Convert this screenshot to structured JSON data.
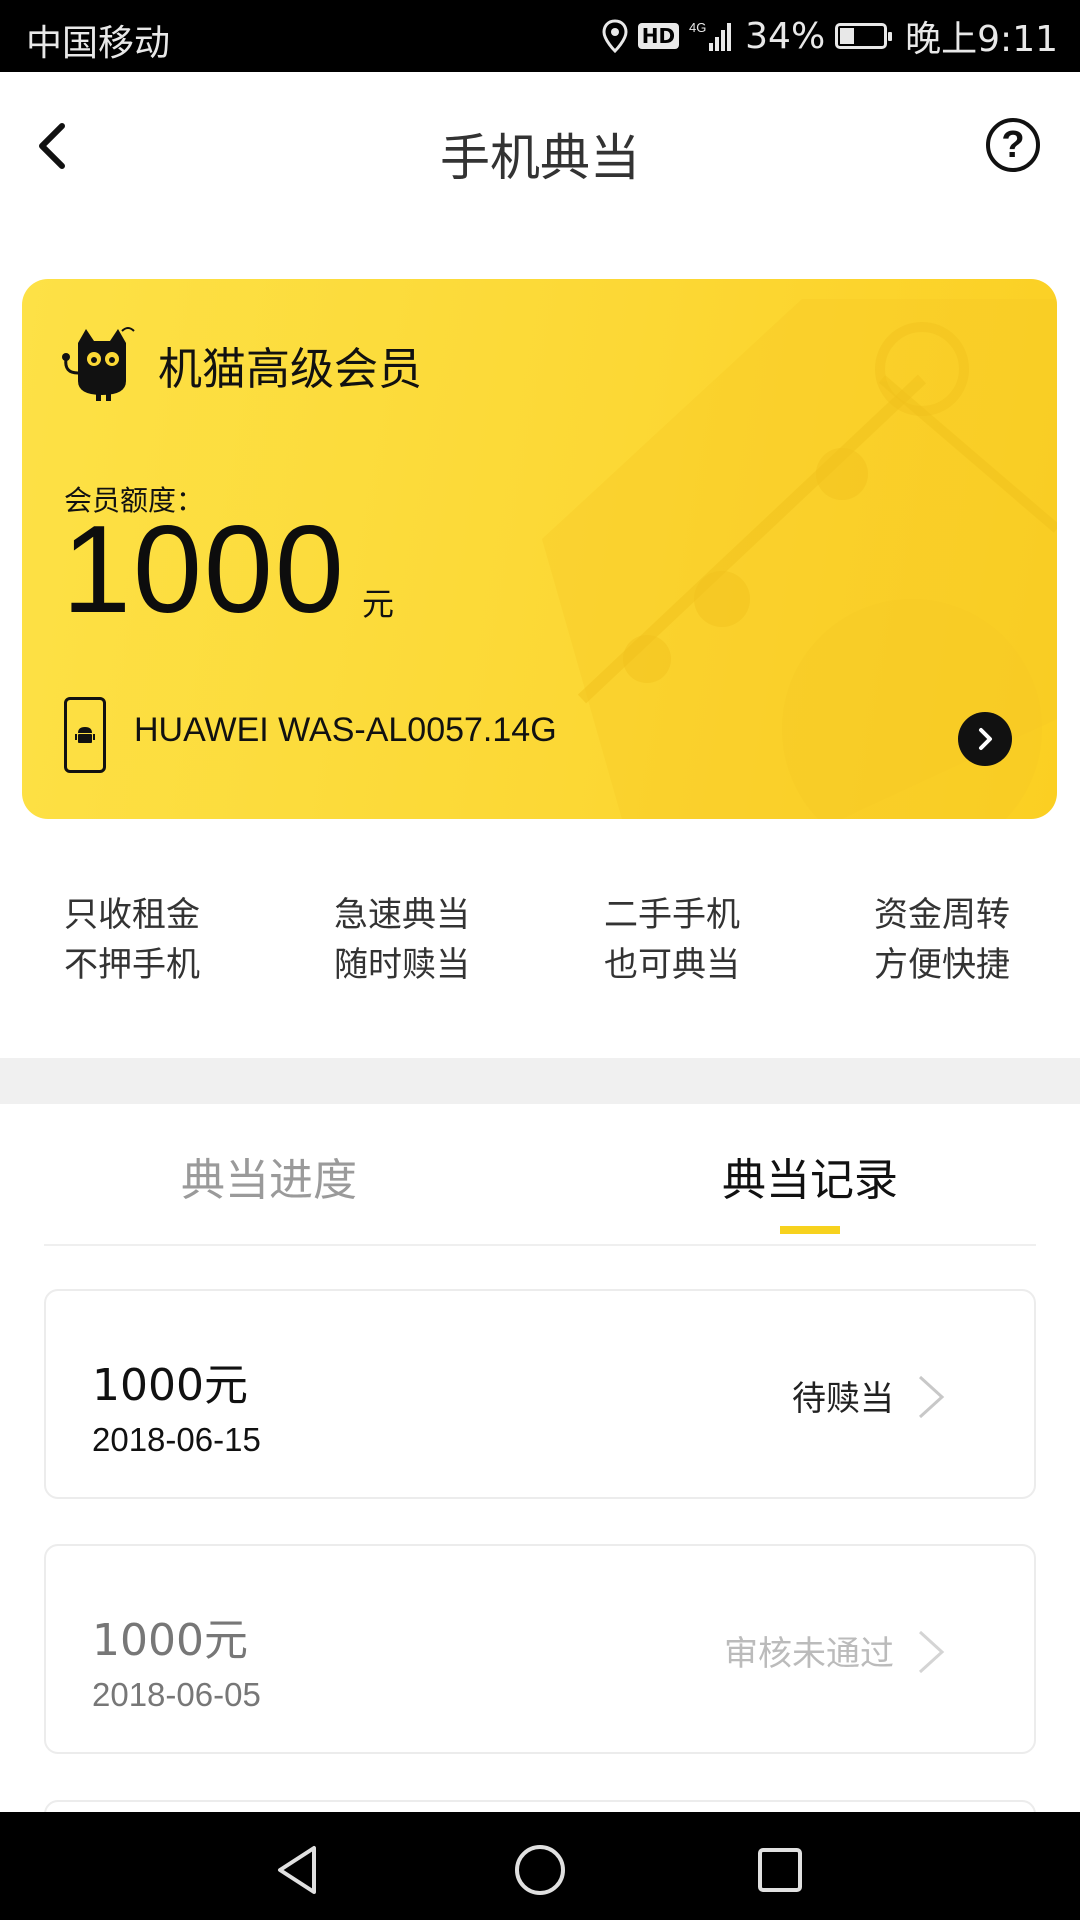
{
  "status_bar": {
    "carrier": "中国移动",
    "network": "4G",
    "battery": "34%",
    "battery_level": 0.34,
    "time": "晚上9:11",
    "icons": [
      "location-icon",
      "hd-badge",
      "signal-icon",
      "battery-icon"
    ]
  },
  "header": {
    "title": "手机典当",
    "back_icon": "chevron-left-icon",
    "help_icon": "question-circle-icon"
  },
  "member_card": {
    "title": "机猫高级会员",
    "quota_label": "会员额度：",
    "quota_value": "1000",
    "quota_unit": "元",
    "device": "HUAWEI WAS-AL00",
    "storage": "57.14G",
    "colors": {
      "gradient_start": "#fde146",
      "gradient_end": "#fbcf22"
    }
  },
  "features": [
    {
      "line1": "只收租金",
      "line2": "不押手机"
    },
    {
      "line1": "急速典当",
      "line2": "随时赎当"
    },
    {
      "line1": "二手手机",
      "line2": "也可典当"
    },
    {
      "line1": "资金周转",
      "line2": "方便快捷"
    }
  ],
  "tabs": [
    {
      "label": "典当进度",
      "active": false
    },
    {
      "label": "典当记录",
      "active": true
    }
  ],
  "accent_color": "#f7d21e",
  "records": [
    {
      "amount": "1000元",
      "date": "2018-06-15",
      "status": "待赎当"
    },
    {
      "amount": "1000元",
      "date": "2018-06-05",
      "status": "审核未通过"
    }
  ],
  "nav": {
    "icons": [
      "back-triangle-icon",
      "home-circle-icon",
      "recents-square-icon"
    ]
  }
}
